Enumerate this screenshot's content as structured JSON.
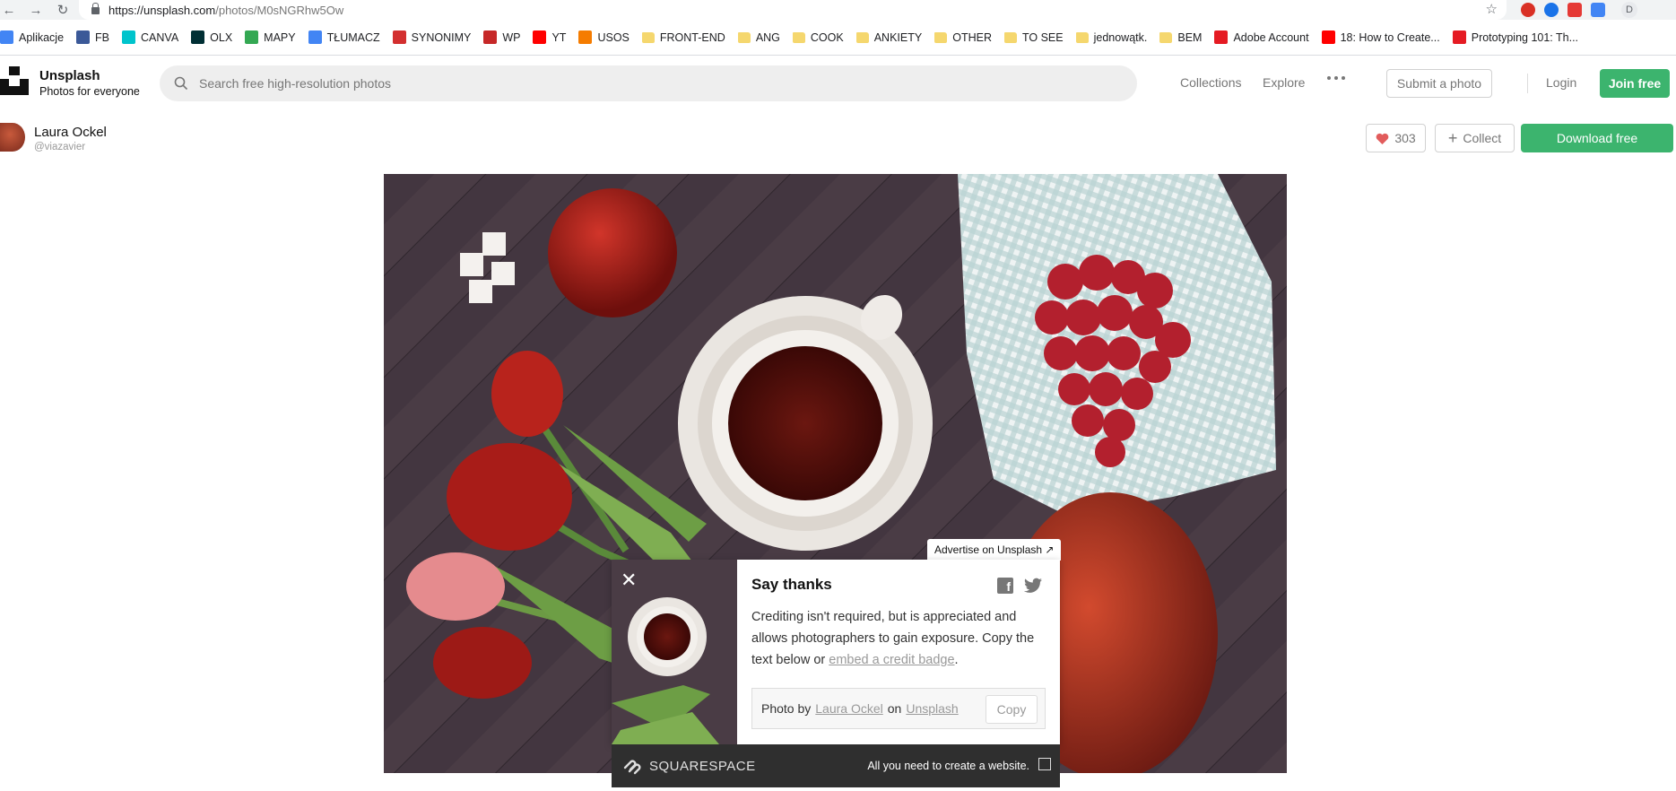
{
  "browser": {
    "url_host": "https://unsplash.com",
    "url_path": "/photos/M0sNGRhw5Ow",
    "avatar_letter": "D",
    "bookmarks": [
      {
        "label": "Aplikacje",
        "icon": "apps-icon",
        "color": "#4285f4"
      },
      {
        "label": "FB",
        "icon": "facebook-icon",
        "color": "#3b5998"
      },
      {
        "label": "CANVA",
        "icon": "canva-icon",
        "color": "#00c4cc"
      },
      {
        "label": "OLX",
        "icon": "olx-icon",
        "color": "#002f34"
      },
      {
        "label": "MAPY",
        "icon": "maps-icon",
        "color": "#34a853"
      },
      {
        "label": "TŁUMACZ",
        "icon": "translate-icon",
        "color": "#4285f4"
      },
      {
        "label": "SYNONIMY",
        "icon": "synonimy-icon",
        "color": "#d32f2f"
      },
      {
        "label": "WP",
        "icon": "wp-icon",
        "color": "#c62828"
      },
      {
        "label": "YT",
        "icon": "youtube-icon",
        "color": "#ff0000"
      },
      {
        "label": "USOS",
        "icon": "usos-icon",
        "color": "#f57c00"
      },
      {
        "label": "FRONT-END",
        "icon": "folder-icon",
        "color": "#f5d76e"
      },
      {
        "label": "ANG",
        "icon": "folder-icon",
        "color": "#f5d76e"
      },
      {
        "label": "COOK",
        "icon": "folder-icon",
        "color": "#f5d76e"
      },
      {
        "label": "ANKIETY",
        "icon": "folder-icon",
        "color": "#f5d76e"
      },
      {
        "label": "OTHER",
        "icon": "folder-icon",
        "color": "#f5d76e"
      },
      {
        "label": "TO SEE",
        "icon": "folder-icon",
        "color": "#f5d76e"
      },
      {
        "label": "jednowątk.",
        "icon": "folder-icon",
        "color": "#f5d76e"
      },
      {
        "label": "BEM",
        "icon": "folder-icon",
        "color": "#f5d76e"
      },
      {
        "label": "Adobe Account",
        "icon": "adobe-icon",
        "color": "#e51b23"
      },
      {
        "label": "18: How to Create...",
        "icon": "youtube-icon",
        "color": "#ff0000"
      },
      {
        "label": "Prototyping 101: Th...",
        "icon": "adobe-icon",
        "color": "#e51b23"
      }
    ]
  },
  "header": {
    "brand_name": "Unsplash",
    "brand_tagline": "Photos for everyone",
    "search_placeholder": "Search free high-resolution photos",
    "nav_collections": "Collections",
    "nav_explore": "Explore",
    "submit_label": "Submit a photo",
    "login_label": "Login",
    "join_label": "Join free",
    "accent_color": "#3cb46e"
  },
  "photographer": {
    "name": "Laura Ockel",
    "handle": "@viazavier",
    "likes": "303",
    "collect_label": "Collect",
    "download_label": "Download free"
  },
  "advertise_label": "Advertise on Unsplash ↗",
  "popup": {
    "title": "Say thanks",
    "body_text": "Crediting isn't required, but is appreciated and allows photographers to gain exposure. Copy the text below or ",
    "badge_link": "embed a credit badge",
    "body_end": ".",
    "credit_prefix": "Photo by",
    "credit_author": "Laura Ockel",
    "credit_on": "on",
    "credit_site": "Unsplash",
    "copy_label": "Copy"
  },
  "ad": {
    "brand": "SQUARESPACE",
    "tagline": "All you need to create a website."
  }
}
